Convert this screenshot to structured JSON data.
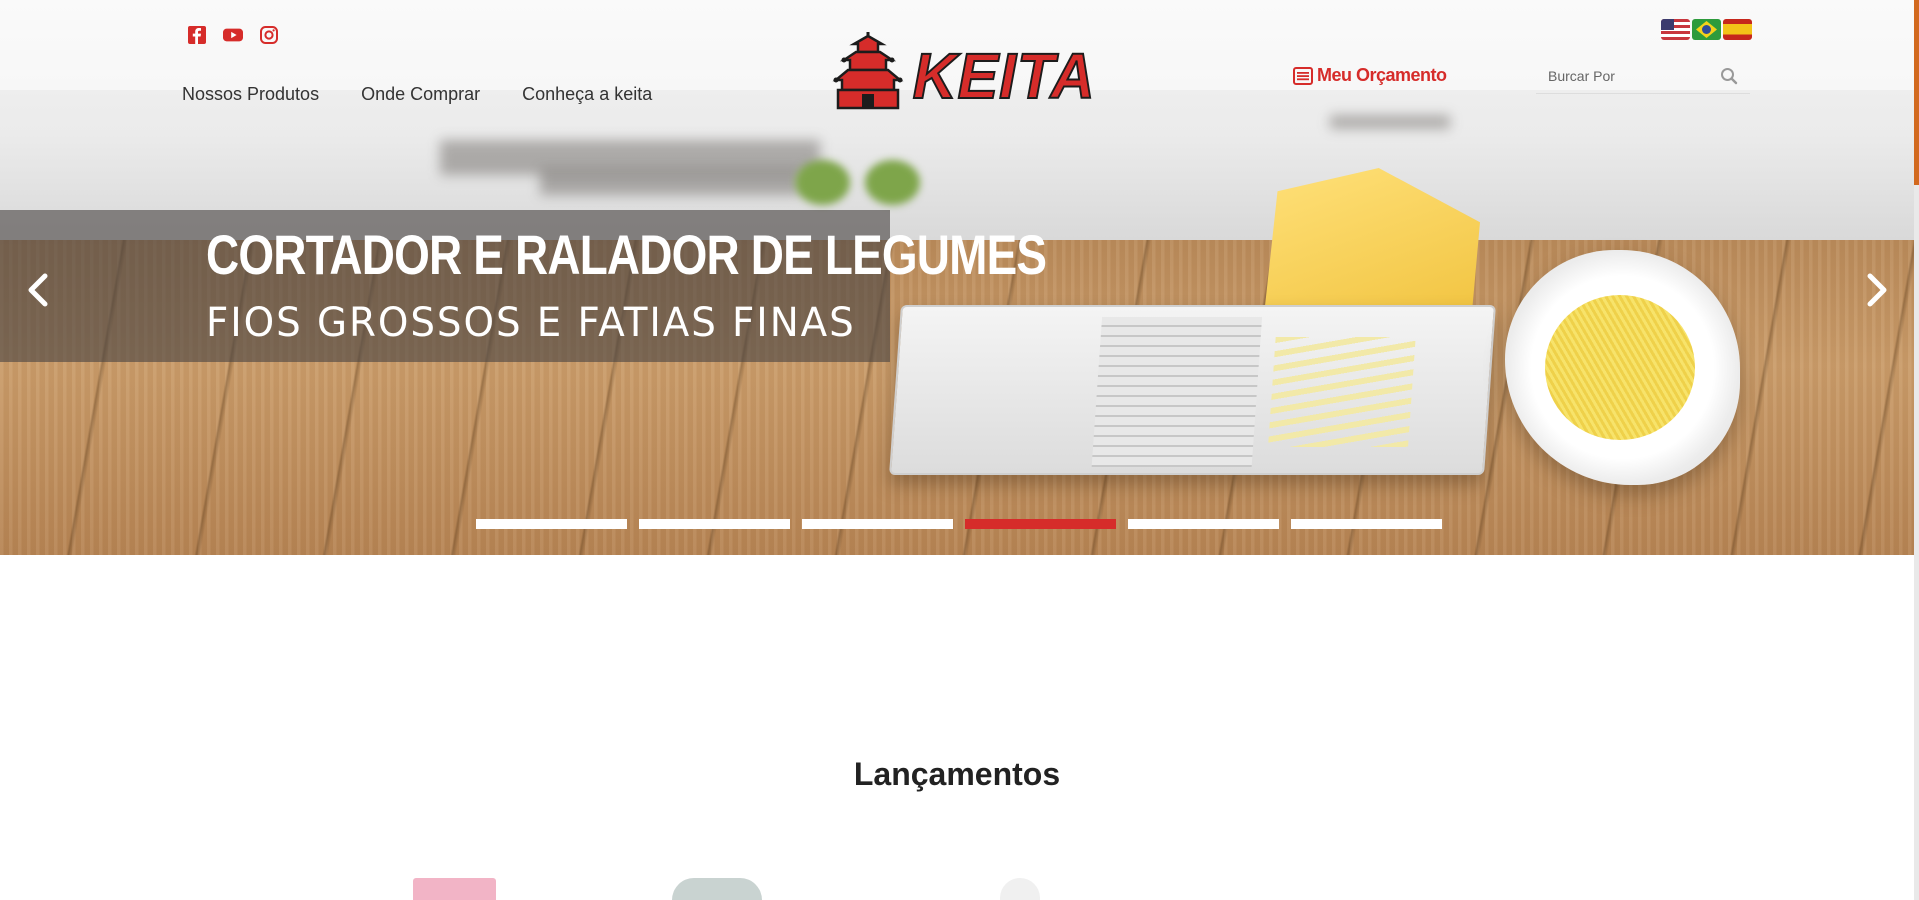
{
  "header": {
    "socials": [
      {
        "icon": "facebook-icon",
        "color": "#d62c2a"
      },
      {
        "icon": "youtube-icon",
        "color": "#d62c2a"
      },
      {
        "icon": "instagram-icon",
        "color": "#d62c2a"
      }
    ],
    "nav": [
      {
        "label": "Nossos Produtos"
      },
      {
        "label": "Onde Comprar"
      },
      {
        "label": "Conheça a keita"
      }
    ],
    "logo_text": "KEITA",
    "budget_label": "Meu Orçamento",
    "search_placeholder": "Burcar Por",
    "flags": [
      "flag-us-icon",
      "flag-br-icon",
      "flag-es-icon"
    ]
  },
  "hero": {
    "title": "CORTADOR E RALADOR DE LEGUMES",
    "subtitle": "FIOS GROSSOS E FATIAS FINAS",
    "slide_count": 6,
    "active_slide": 4
  },
  "main": {
    "section_title": "Lançamentos"
  },
  "colors": {
    "accent": "#d62c2a",
    "text": "#333333"
  }
}
